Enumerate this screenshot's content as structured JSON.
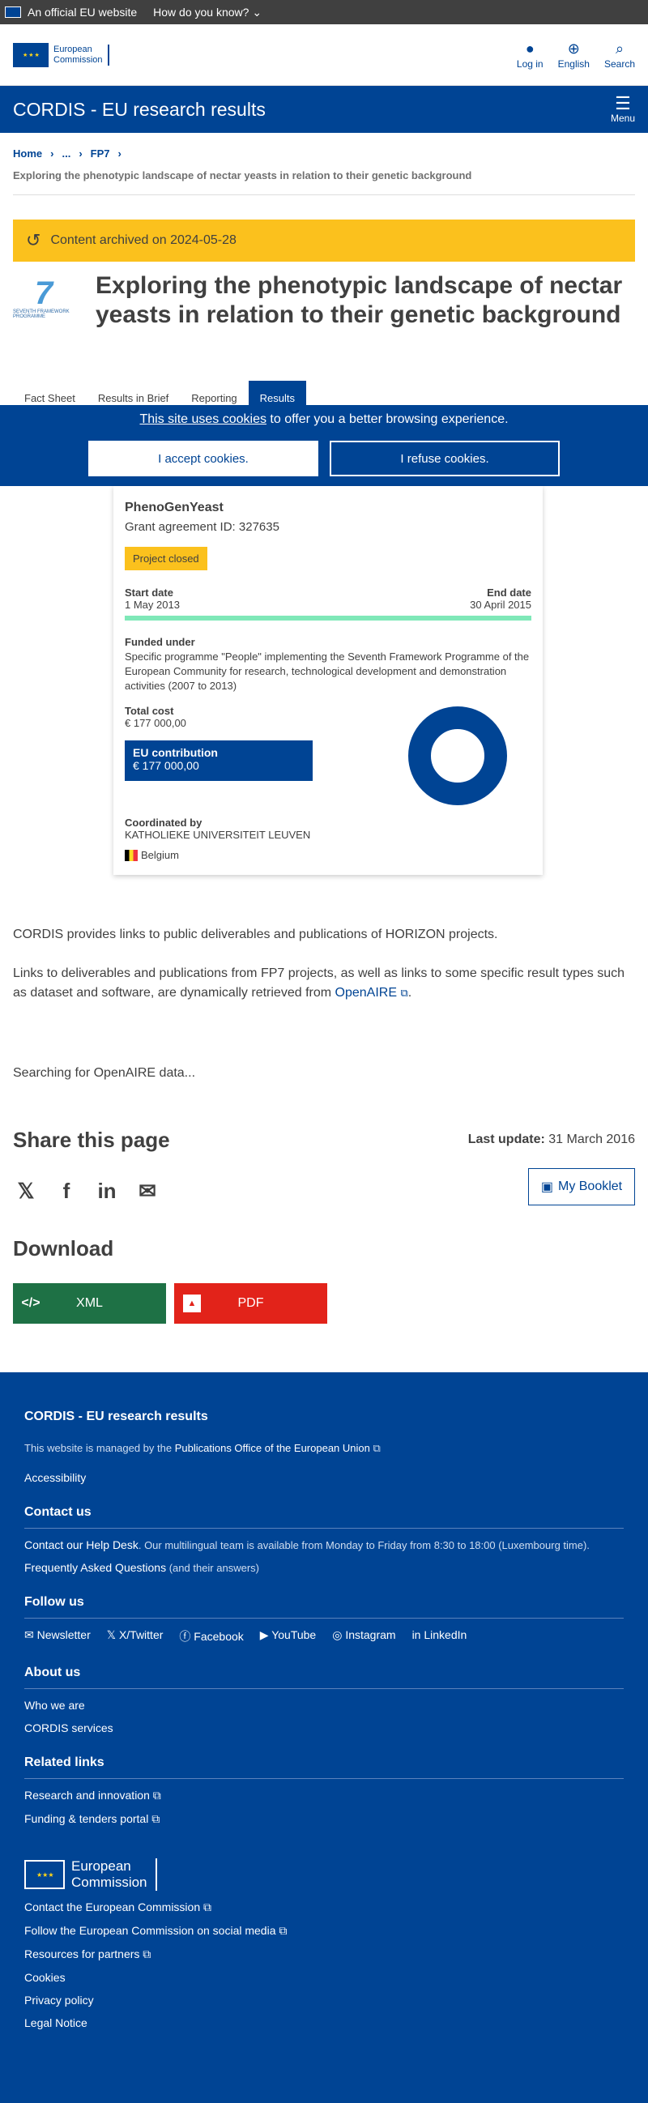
{
  "topbar": {
    "official": "An official EU website",
    "know": "How do you know?"
  },
  "header": {
    "logo_line1": "European",
    "logo_line2": "Commission",
    "login": "Log in",
    "language": "English",
    "search": "Search"
  },
  "site": {
    "title": "CORDIS - EU research results",
    "menu": "Menu"
  },
  "breadcrumb": {
    "home": "Home",
    "ellipsis": "...",
    "fp7": "FP7",
    "current": "Exploring the phenotypic landscape of nectar yeasts in relation to their genetic background"
  },
  "archived": "Content archived on 2024-05-28",
  "fp7_logo_text": "SEVENTH FRAMEWORK PROGRAMME",
  "title": "Exploring the phenotypic landscape of nectar yeasts in relation to their genetic background",
  "tabs": [
    "Fact Sheet",
    "Results in Brief",
    "Reporting",
    "Results"
  ],
  "cookie": {
    "link": "This site uses cookies",
    "rest": " to offer you a better browsing experience.",
    "accept": "I accept cookies.",
    "refuse": "I refuse cookies."
  },
  "project": {
    "acronym": "PhenoGenYeast",
    "grant": "Grant agreement ID: 327635",
    "status": "Project closed",
    "start_label": "Start date",
    "start": "1 May 2013",
    "end_label": "End date",
    "end": "30 April 2015",
    "funded_label": "Funded under",
    "funded": "Specific programme \"People\" implementing the Seventh Framework Programme of the European Community for research, technological development and demonstration activities (2007 to 2013)",
    "cost_label": "Total cost",
    "cost": "€ 177 000,00",
    "contrib_label": "EU contribution",
    "contrib": "€ 177 000,00",
    "coord_label": "Coordinated by",
    "coord": "KATHOLIEKE UNIVERSITEIT LEUVEN",
    "country": "Belgium"
  },
  "body": {
    "p1": "CORDIS provides links to public deliverables and publications of HORIZON projects.",
    "p2": "Links to deliverables and publications from FP7 projects, as well as links to some specific result types such as dataset and software, are dynamically retrieved from ",
    "openaire": "OpenAIRE",
    "searching": "Searching for OpenAIRE data..."
  },
  "share": {
    "title": "Share this page",
    "last_update_label": "Last update:",
    "last_update": "31 March 2016",
    "booklet": "My Booklet"
  },
  "download": {
    "title": "Download",
    "xml": "XML",
    "pdf": "PDF"
  },
  "footer": {
    "site": "CORDIS - EU research results",
    "managed": "This website is managed by the ",
    "managed_link": "Publications Office of the European Union",
    "accessibility": "Accessibility",
    "contact_h": "Contact us",
    "helpdesk": "Contact our Help Desk",
    "helpdesk_text": ". Our multilingual team is available from Monday to Friday from 8:30 to 18:00 (Luxembourg time).",
    "faq": "Frequently Asked Questions",
    "faq_text": " (and their answers)",
    "follow_h": "Follow us",
    "social": [
      "Newsletter",
      "X/Twitter",
      "Facebook",
      "YouTube",
      "Instagram",
      "LinkedIn"
    ],
    "about_h": "About us",
    "about": [
      "Who we are",
      "CORDIS services"
    ],
    "related_h": "Related links",
    "related": [
      "Research and innovation",
      "Funding & tenders portal"
    ],
    "ec1": "European",
    "ec2": "Commission",
    "bottom": [
      "Contact the European Commission",
      "Follow the European Commission on social media",
      "Resources for partners",
      "Cookies",
      "Privacy policy",
      "Legal Notice"
    ]
  },
  "colors": {
    "primary": "#004494",
    "archived": "#fbc11d",
    "xml": "#1e7145",
    "pdf": "#e2231a",
    "progress": "#7fe8b8"
  }
}
